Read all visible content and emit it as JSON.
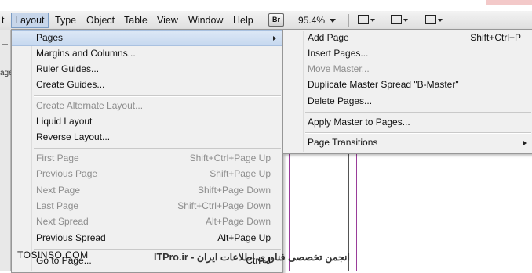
{
  "menubar": {
    "items": [
      {
        "label": "t"
      },
      {
        "label": "Layout"
      },
      {
        "label": "Type"
      },
      {
        "label": "Object"
      },
      {
        "label": "Table"
      },
      {
        "label": "View"
      },
      {
        "label": "Window"
      },
      {
        "label": "Help"
      }
    ],
    "br_label": "Br",
    "zoom": "95.4%"
  },
  "layout_menu": [
    {
      "label": "Pages",
      "shortcut": "",
      "disabled": false,
      "submenu": true,
      "highlighted": true
    },
    {
      "label": "Margins and Columns...",
      "shortcut": "",
      "disabled": false
    },
    {
      "label": "Ruler Guides...",
      "shortcut": "",
      "disabled": false
    },
    {
      "label": "Create Guides...",
      "shortcut": "",
      "disabled": false
    },
    {
      "label": "Create Alternate Layout...",
      "shortcut": "",
      "disabled": true
    },
    {
      "label": "Liquid Layout",
      "shortcut": "",
      "disabled": false
    },
    {
      "label": "Reverse Layout...",
      "shortcut": "",
      "disabled": false
    },
    {
      "label": "First Page",
      "shortcut": "Shift+Ctrl+Page Up",
      "disabled": true
    },
    {
      "label": "Previous Page",
      "shortcut": "Shift+Page Up",
      "disabled": true
    },
    {
      "label": "Next Page",
      "shortcut": "Shift+Page Down",
      "disabled": true
    },
    {
      "label": "Last Page",
      "shortcut": "Shift+Ctrl+Page Down",
      "disabled": true
    },
    {
      "label": "Next Spread",
      "shortcut": "Alt+Page Down",
      "disabled": true
    },
    {
      "label": "Previous Spread",
      "shortcut": "Alt+Page Up",
      "disabled": false
    },
    {
      "label": "Go to Page...",
      "shortcut": "Ctrl+J",
      "disabled": false
    }
  ],
  "pages_submenu": [
    {
      "label": "Add Page",
      "shortcut": "Shift+Ctrl+P",
      "disabled": false
    },
    {
      "label": "Insert Pages...",
      "shortcut": "",
      "disabled": false
    },
    {
      "label": "Move Master...",
      "shortcut": "",
      "disabled": true
    },
    {
      "label": "Duplicate Master Spread \"B-Master\"",
      "shortcut": "",
      "disabled": false
    },
    {
      "label": "Delete Pages...",
      "shortcut": "",
      "disabled": false
    },
    {
      "label": "Apply Master to Pages...",
      "shortcut": "",
      "disabled": false
    },
    {
      "label": "Page Transitions",
      "shortcut": "",
      "disabled": false,
      "submenu": true
    }
  ],
  "watermark": {
    "left": "TOSINSO.COM",
    "right": "ITPro.ir - انجمن تخصصی فناوری اطلاعات ایران"
  },
  "left_strip": {
    "label": "age"
  },
  "colors": {
    "highlight": "#c6d8ef",
    "menu_bg": "#f0f0f0",
    "guide_purple": "#9a3d9a"
  }
}
